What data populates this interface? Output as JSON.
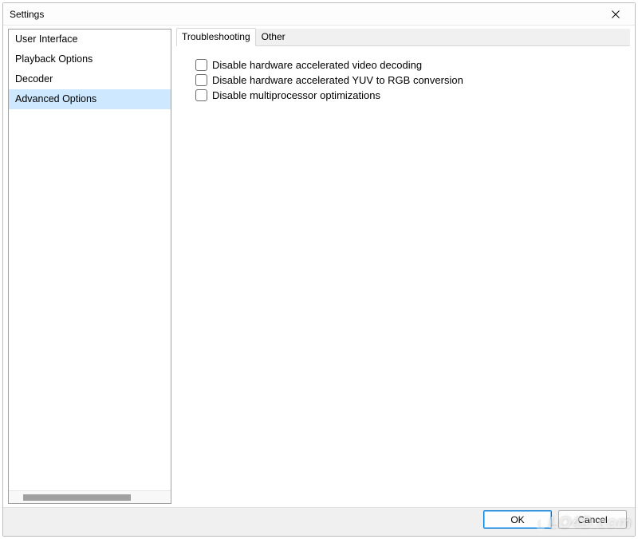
{
  "window": {
    "title": "Settings"
  },
  "sidebar": {
    "items": [
      {
        "label": "User Interface",
        "selected": false
      },
      {
        "label": "Playback Options",
        "selected": false
      },
      {
        "label": "Decoder",
        "selected": false
      },
      {
        "label": "Advanced Options",
        "selected": true
      }
    ]
  },
  "main": {
    "tabs": [
      {
        "label": "Troubleshooting",
        "active": true
      },
      {
        "label": "Other",
        "active": false
      }
    ],
    "checkboxes": [
      {
        "label": "Disable hardware accelerated video decoding",
        "checked": false
      },
      {
        "label": "Disable hardware accelerated YUV to RGB conversion",
        "checked": false
      },
      {
        "label": "Disable multiprocessor optimizations",
        "checked": false
      }
    ]
  },
  "footer": {
    "ok_label": "OK",
    "cancel_label": "Cancel"
  },
  "watermark": {
    "text": "LO4D.com"
  }
}
